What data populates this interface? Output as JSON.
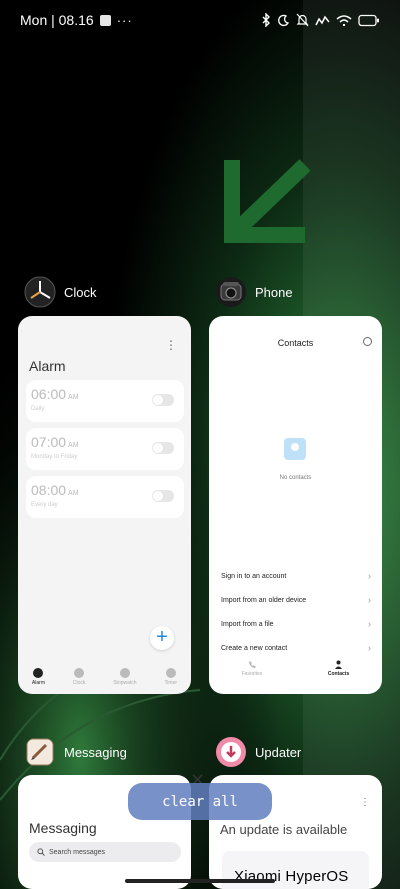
{
  "status_bar": {
    "time": "Mon | 08.16",
    "more": "···",
    "icons": [
      "bluetooth-icon",
      "moon-icon",
      "bell-mute-icon",
      "signal-icon",
      "wifi-icon",
      "battery-icon"
    ]
  },
  "apps": [
    {
      "name": "Clock",
      "icon": "clock-app-icon",
      "card": {
        "more": "⋮",
        "title": "Alarm",
        "alarms": [
          {
            "time": "06:00",
            "ampm": "AM",
            "label": "Daily"
          },
          {
            "time": "07:00",
            "ampm": "AM",
            "label": "Monday to Friday"
          },
          {
            "time": "08:00",
            "ampm": "AM",
            "label": "Every day"
          }
        ],
        "fab": "+",
        "tabs": [
          {
            "label": "Alarm",
            "icon": "alarm-icon",
            "active": true
          },
          {
            "label": "Clock",
            "icon": "world-clock-icon",
            "active": false
          },
          {
            "label": "Stopwatch",
            "icon": "stopwatch-icon",
            "active": false
          },
          {
            "label": "Timer",
            "icon": "hourglass-icon",
            "active": false
          }
        ]
      }
    },
    {
      "name": "Phone",
      "icon": "phone-app-icon",
      "card": {
        "title": "Contacts",
        "empty": "No contacts",
        "options": [
          "Sign in to an account",
          "Import from an older device",
          "Import from a file",
          "Create a new contact"
        ],
        "tabs": [
          {
            "label": "Favorites",
            "icon": "phone-icon",
            "active": false
          },
          {
            "label": "Contacts",
            "icon": "person-icon",
            "active": true
          }
        ]
      }
    },
    {
      "name": "Messaging",
      "icon": "messaging-app-icon",
      "card": {
        "title": "Messaging",
        "search_placeholder": "Search messages"
      }
    },
    {
      "name": "Updater",
      "icon": "updater-app-icon",
      "card": {
        "more": "⋮",
        "title": "An update is available",
        "brand": "Xiaomi HyperOS"
      }
    }
  ],
  "controls": {
    "close": "✕",
    "clear_all": "clear all"
  },
  "colors": {
    "accent_blue": "#1e88e5",
    "clear_all_bg": "#607ebe",
    "wallpaper_green": "#1f7a3a"
  }
}
